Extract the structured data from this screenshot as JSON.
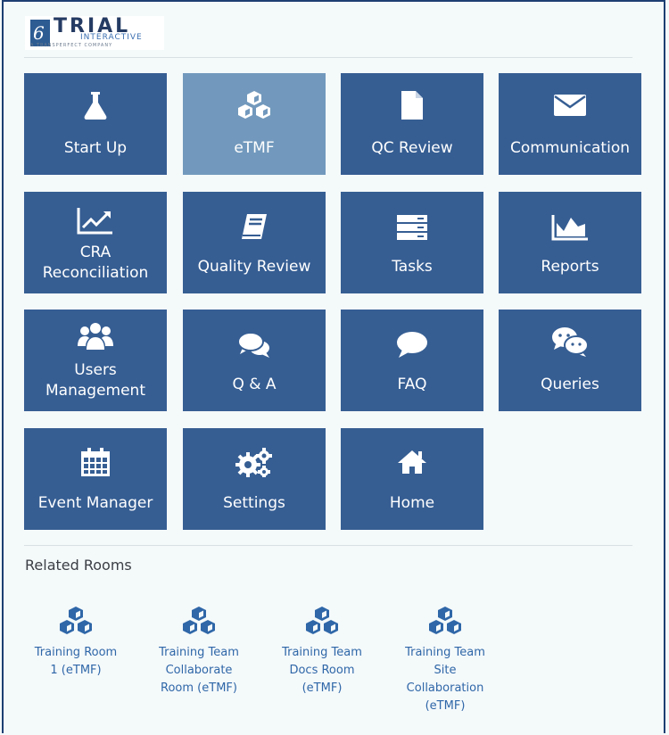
{
  "logo": {
    "title": "TRIAL",
    "subtitle": "INTERACTIVE",
    "tagline": "A TRANSPERFECT COMPANY"
  },
  "tiles": [
    {
      "label": "Start Up",
      "icon": "flask-icon",
      "active": false
    },
    {
      "label": "eTMF",
      "icon": "cubes-icon",
      "active": true
    },
    {
      "label": "QC Review",
      "icon": "document-icon",
      "active": false
    },
    {
      "label": "Communication",
      "icon": "envelope-icon",
      "active": false
    },
    {
      "label": "CRA Reconciliation",
      "line1": "CRA",
      "line2": "Reconciliation",
      "icon": "line-chart-icon",
      "active": false
    },
    {
      "label": "Quality Review",
      "icon": "book-icon",
      "active": false
    },
    {
      "label": "Tasks",
      "icon": "server-list-icon",
      "active": false
    },
    {
      "label": "Reports",
      "icon": "area-chart-icon",
      "active": false
    },
    {
      "label": "Users Management",
      "line1": "Users",
      "line2": "Management",
      "icon": "users-icon",
      "active": false
    },
    {
      "label": "Q & A",
      "icon": "comments-icon",
      "active": false
    },
    {
      "label": "FAQ",
      "icon": "comment-icon",
      "active": false
    },
    {
      "label": "Queries",
      "icon": "wechat-icon",
      "active": false
    },
    {
      "label": "Event Manager",
      "icon": "calendar-icon",
      "active": false
    },
    {
      "label": "Settings",
      "icon": "cogs-icon",
      "active": false
    },
    {
      "label": "Home",
      "icon": "home-icon",
      "active": false
    }
  ],
  "related": {
    "title": "Related Rooms",
    "rooms": [
      {
        "lines": [
          "Training Room",
          "1 (eTMF)"
        ],
        "icon": "cubes-icon"
      },
      {
        "lines": [
          "Training Team",
          "Collaborate",
          "Room (eTMF)"
        ],
        "icon": "cubes-icon"
      },
      {
        "lines": [
          "Training Team",
          "Docs Room",
          "(eTMF)"
        ],
        "icon": "cubes-icon"
      },
      {
        "lines": [
          "Training Team",
          "Site",
          "Collaboration",
          "(eTMF)"
        ],
        "icon": "cubes-icon"
      }
    ]
  },
  "colors": {
    "tile": "#365e93",
    "tile_active": "#7299bd",
    "link": "#2f67a8",
    "background": "#f4f9fa"
  }
}
